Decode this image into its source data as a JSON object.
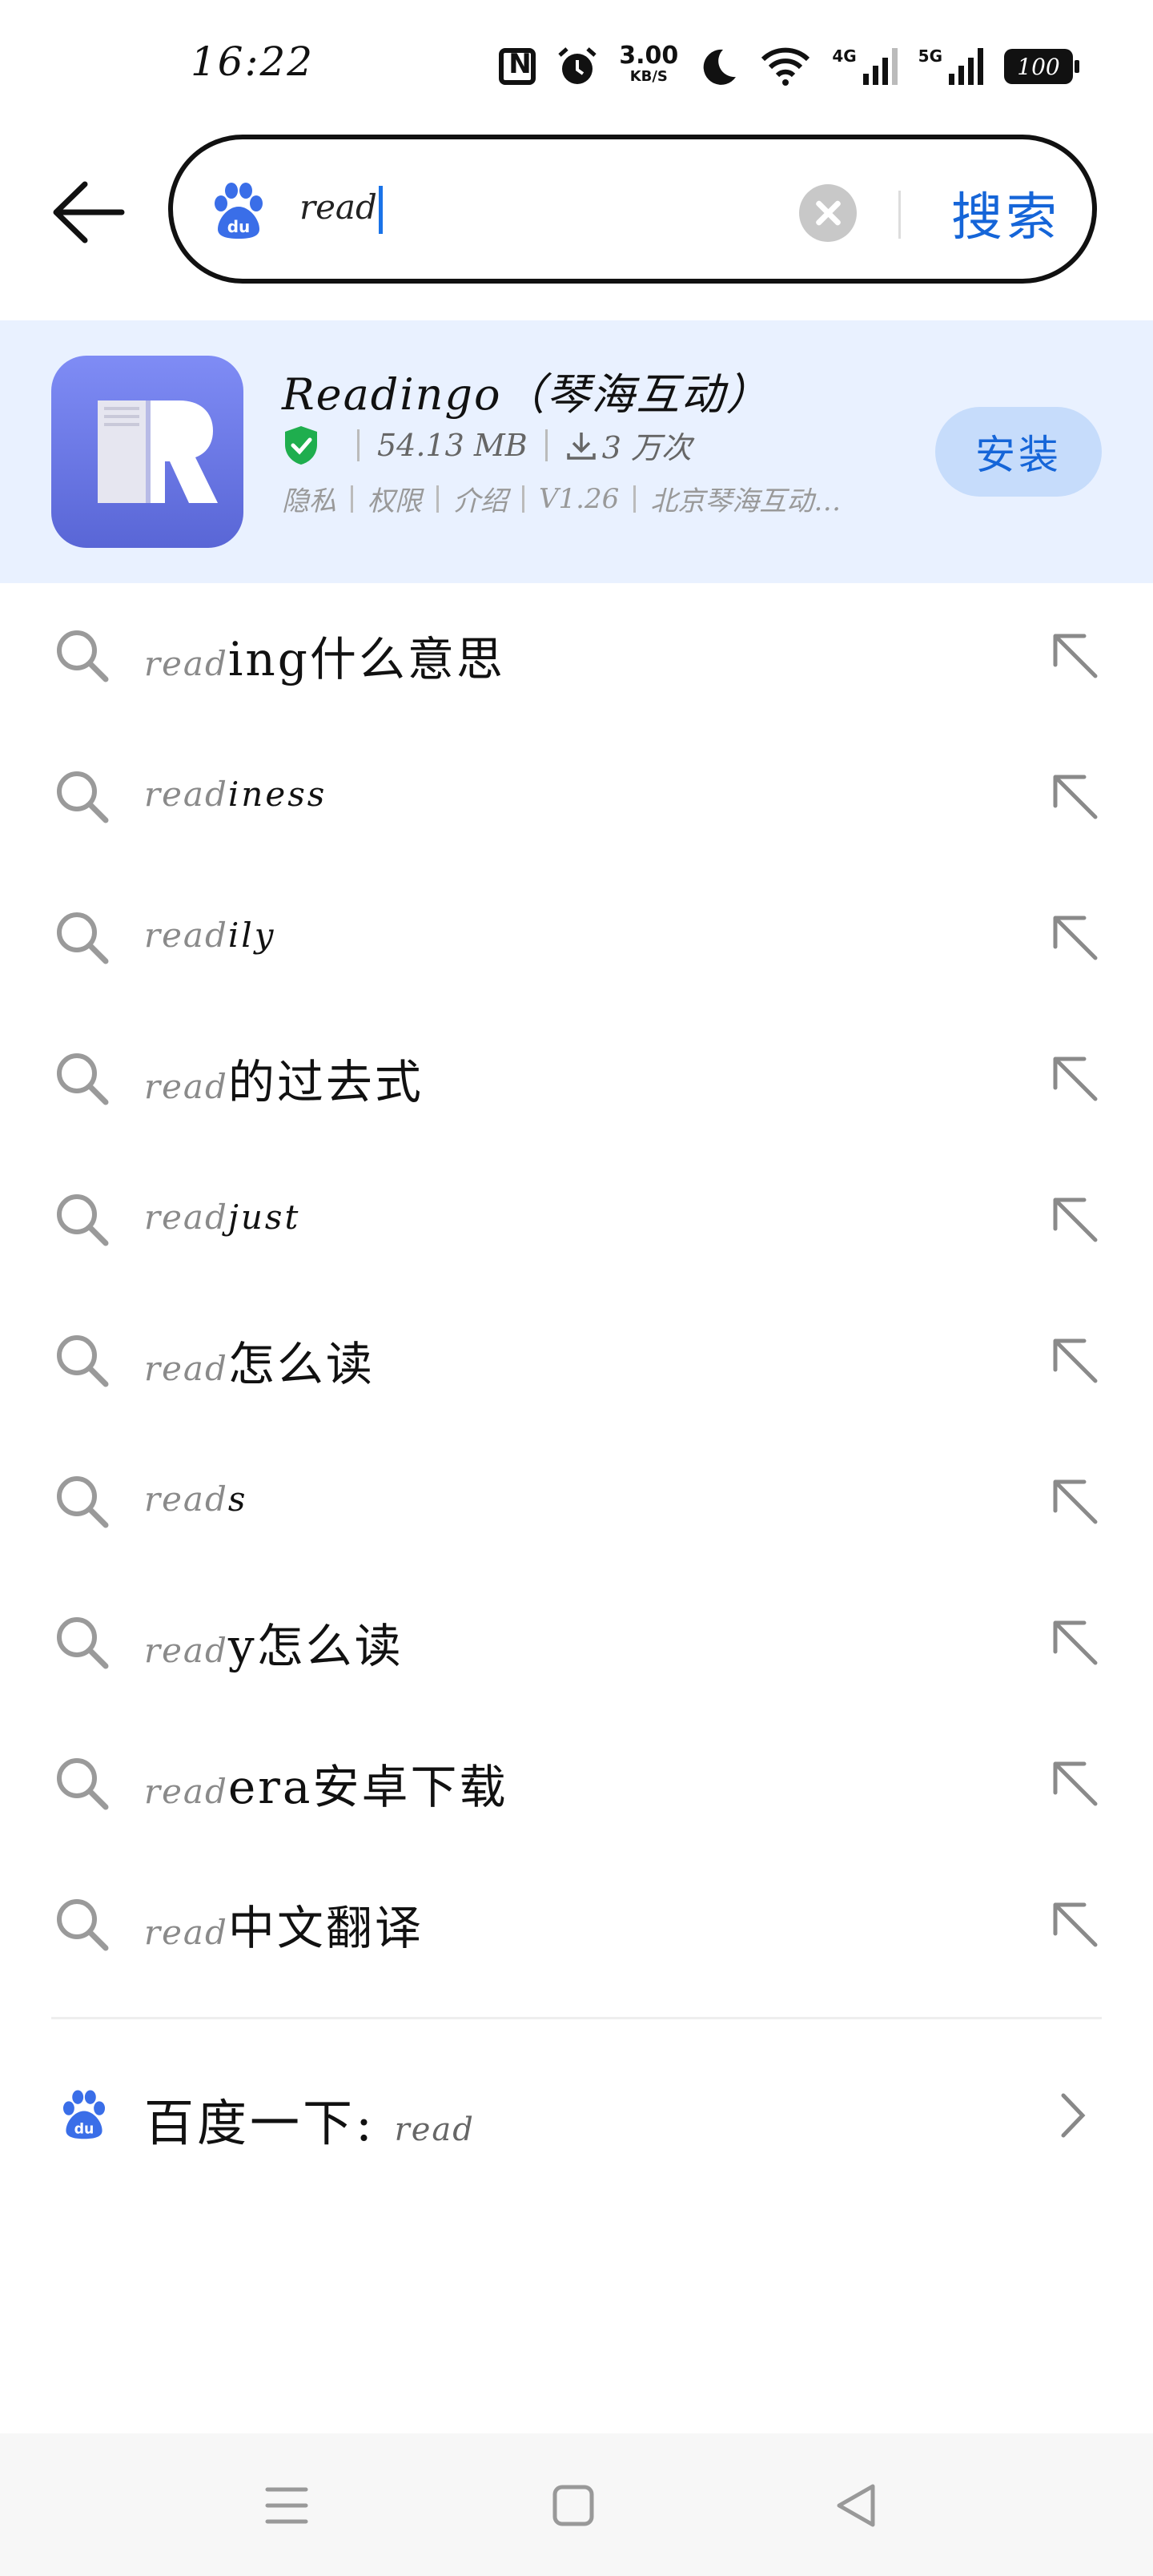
{
  "status": {
    "time": "16:22",
    "speed_value": "3.00",
    "speed_unit": "KB/S",
    "net1": "4G",
    "net2": "5G",
    "battery": "100"
  },
  "search": {
    "query": "read",
    "button_label": "搜索"
  },
  "app": {
    "name": "Readingo（琴海互动）",
    "size": "54.13 MB",
    "downloads": "3 万次",
    "links": [
      "隐私",
      "权限",
      "介绍",
      "V1.26",
      "北京琴海互动…"
    ],
    "install_label": "安装",
    "icon_color": "#6f7bea"
  },
  "suggestions": [
    {
      "prefix": "read",
      "rest": "ing什么意思",
      "latin": false
    },
    {
      "prefix": "read",
      "rest": "iness",
      "latin": true
    },
    {
      "prefix": "read",
      "rest": "ily",
      "latin": true
    },
    {
      "prefix": "read",
      "rest": "的过去式",
      "latin": false
    },
    {
      "prefix": "read",
      "rest": "just",
      "latin": true
    },
    {
      "prefix": "read",
      "rest": "怎么读",
      "latin": false
    },
    {
      "prefix": "read",
      "rest": "s",
      "latin": true
    },
    {
      "prefix": "read",
      "rest": "y怎么读",
      "latin": false
    },
    {
      "prefix": "read",
      "rest": "era安卓下载",
      "latin": false
    },
    {
      "prefix": "read",
      "rest": "中文翻译",
      "latin": false
    }
  ],
  "baidu": {
    "label": "百度一下: ",
    "query": "read"
  },
  "colors": {
    "accent": "#1565d8",
    "card_bg": "#e9f1ff",
    "install_bg": "#c6dcfb",
    "baidu_blue": "#3a6ee8",
    "shield_green": "#1fae4e"
  },
  "icons": [
    "back-arrow-icon",
    "baidu-logo-icon",
    "clear-icon",
    "verified-shield-icon",
    "download-icon",
    "search-icon",
    "fill-arrow-icon",
    "chevron-right-icon",
    "menu-icon",
    "home-icon",
    "back-triangle-icon"
  ]
}
